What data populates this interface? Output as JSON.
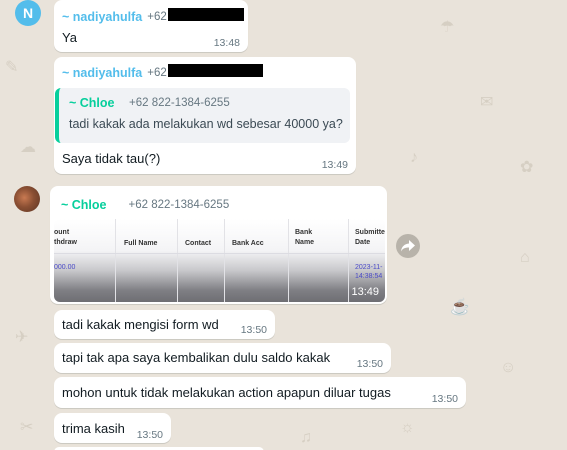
{
  "messages": [
    {
      "sender_name": "~ nadiyahulfa",
      "sender_phone": "+62",
      "avatar_letter": "N",
      "text": "Ya",
      "time": "13:48"
    },
    {
      "sender_name": "~ nadiyahulfa",
      "sender_phone": "+62",
      "quoted": {
        "name": "~ Chloe",
        "phone": "+62 822-1384-6255",
        "text": "tadi kakak ada melakukan wd sebesar 40000 ya?"
      },
      "text": "Saya tidak tau(?)",
      "time": "13:49"
    },
    {
      "sender_name": "~ Chloe",
      "sender_phone": "+62 822-1384-6255",
      "image": {
        "columns": [
          "ount\nthdraw",
          "Full Name",
          "Contact",
          "Bank Acc",
          "Bank\nName",
          "Submitte\nDate"
        ],
        "cells": [
          "000.00",
          "2023-11-\n14:38:54"
        ],
        "time": "13:49"
      }
    },
    {
      "text": "tadi kakak mengisi form wd",
      "time": "13:50"
    },
    {
      "text": "tapi tak apa saya kembalikan dulu saldo kakak",
      "time": "13:50"
    },
    {
      "text": "mohon untuk tidak melakukan action apapun diluar tugas",
      "time": "13:50"
    },
    {
      "text": "trima kasih",
      "time": "13:50"
    }
  ],
  "colors": {
    "nadiyahulfa": "#53bdeb",
    "chloe": "#06cf9c",
    "avatar_n": "#53bdeb",
    "wallpaper": "#e9e3da"
  },
  "icons": [
    "forward-icon"
  ]
}
